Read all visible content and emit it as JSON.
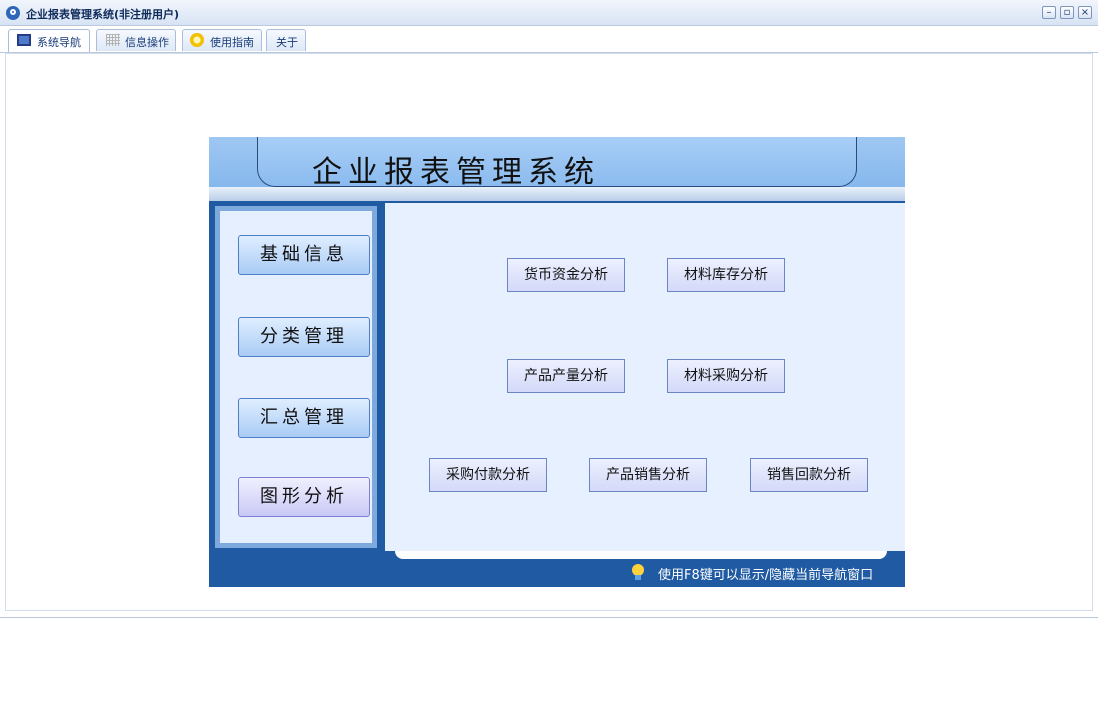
{
  "window": {
    "title": "企业报表管理系统(非注册用户)",
    "controls": {
      "minimize": "–",
      "restore": "▫",
      "close": "×"
    }
  },
  "tabs": [
    {
      "label": "系统导航",
      "icon": "monitor-icon",
      "active": true
    },
    {
      "label": "信息操作",
      "icon": "grid-icon",
      "active": false
    },
    {
      "label": "使用指南",
      "icon": "help-sun-icon",
      "active": false
    },
    {
      "label": "关于",
      "active": false
    }
  ],
  "panel": {
    "title": "企业报表管理系统",
    "sidebar": [
      {
        "label": "基础信息"
      },
      {
        "label": "分类管理"
      },
      {
        "label": "汇总管理"
      },
      {
        "label": "图形分析"
      }
    ],
    "functions": [
      {
        "label": "货币资金分析"
      },
      {
        "label": "材料库存分析"
      },
      {
        "label": "产品产量分析"
      },
      {
        "label": "材料采购分析"
      },
      {
        "label": "采购付款分析"
      },
      {
        "label": "产品销售分析"
      },
      {
        "label": "销售回款分析"
      }
    ],
    "tip": "使用F8键可以显示/隐藏当前导航窗口"
  },
  "colors": {
    "accent": "#1f5aa3",
    "header": "#8fbcf0",
    "content_bg": "#e7f0ff"
  }
}
